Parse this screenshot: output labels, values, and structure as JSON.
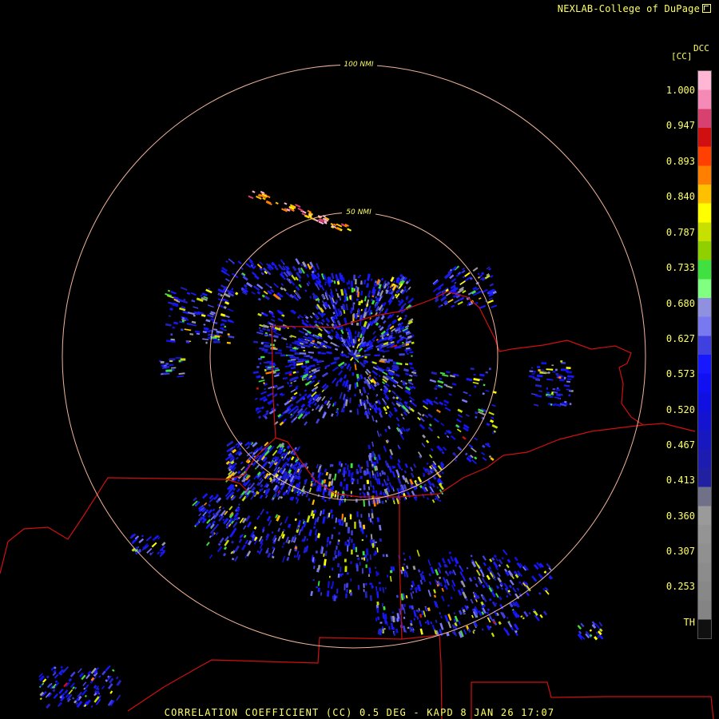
{
  "credit": "NEXLAB-College of DuPage",
  "colorbar": {
    "product": "DCC",
    "unit": "[CC]",
    "ticks": [
      "1.000",
      "0.947",
      "0.893",
      "0.840",
      "0.787",
      "0.733",
      "0.680",
      "0.627",
      "0.573",
      "0.520",
      "0.467",
      "0.413",
      "0.360",
      "0.307",
      "0.253",
      "TH"
    ],
    "colors": [
      "#ffb6d5",
      "#f58ab6",
      "#d84070",
      "#d01010",
      "#ff4000",
      "#ff8000",
      "#ffc000",
      "#ffff00",
      "#c8e000",
      "#90d000",
      "#40e040",
      "#80ff80",
      "#9090e0",
      "#7878f0",
      "#4040e0",
      "#1818ff",
      "#1010f0",
      "#1010e0",
      "#1414d0",
      "#1818c0",
      "#1c1cb0",
      "#2020a0",
      "#707088",
      "#9a9a9a",
      "#949494",
      "#909090",
      "#8c8c8c",
      "#888888",
      "#848484",
      "#101010"
    ]
  },
  "rings": [
    {
      "label": "100 NMI"
    },
    {
      "label": "50 NMI"
    }
  ],
  "footer": "CORRELATION COEFFICIENT (CC) 0.5 DEG - KAPD 8 JAN 26 17:07"
}
